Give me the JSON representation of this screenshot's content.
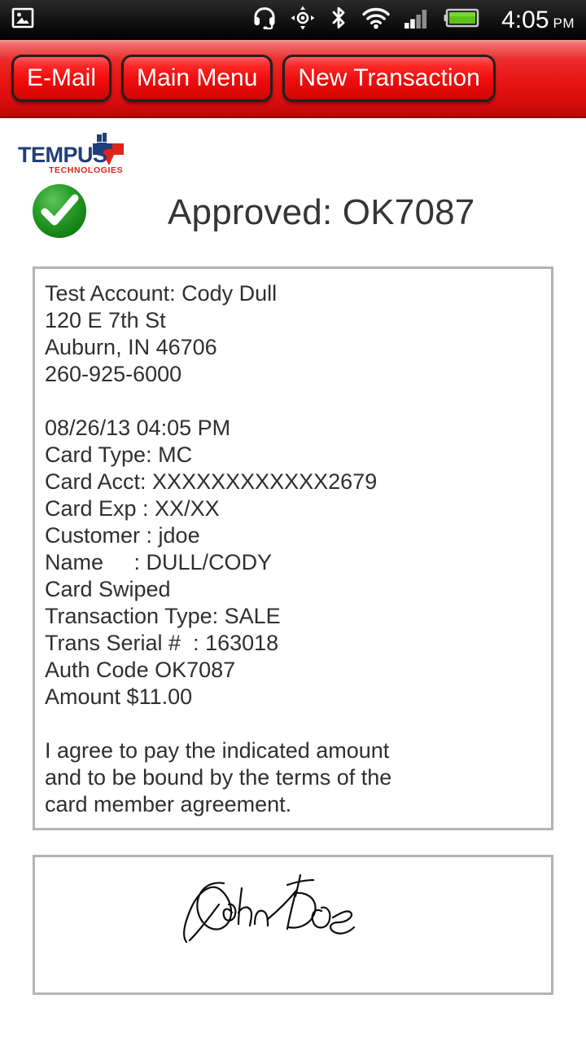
{
  "status_bar": {
    "left_icons": [
      {
        "name": "screenshot-image-icon",
        "label": "Screenshot saved"
      }
    ],
    "right_icons": [
      {
        "name": "headset-icon",
        "label": "Headset connected"
      },
      {
        "name": "gps-crosshair-icon",
        "label": "GPS active"
      },
      {
        "name": "bluetooth-icon",
        "label": "Bluetooth on"
      },
      {
        "name": "wifi-icon",
        "label": "Wi-Fi connected"
      },
      {
        "name": "cellular-signal-icon",
        "label": "Cellular signal"
      },
      {
        "name": "battery-full-icon",
        "label": "Battery full"
      }
    ],
    "clock_time": "4:05",
    "clock_ampm": "PM",
    "background": "#0a0a0a",
    "text_color": "#ffffff"
  },
  "nav_bar": {
    "background_red": "#e81414",
    "border_color": "#231f1f",
    "buttons": [
      {
        "name": "email-button",
        "label": "E-Mail"
      },
      {
        "name": "main-menu-button",
        "label": "Main Menu"
      },
      {
        "name": "new-transaction-button",
        "label": "New Transaction"
      }
    ]
  },
  "brand": {
    "name": "TEMPUS",
    "tagline": "TECHNOLOGIES",
    "navy": "#1f3f7a",
    "red": "#e2231a"
  },
  "result": {
    "status_icon": "green-check-icon",
    "status_color": "#1d9b1d",
    "heading": "Approved: OK7087",
    "heading_color": "#353535"
  },
  "receipt": {
    "border_color": "#b4b4b4",
    "text_color": "#2f2f2f",
    "lines": [
      "Test Account: Cody Dull",
      "120 E 7th St",
      "Auburn, IN 46706",
      "260-925-6000",
      "",
      "08/26/13 04:05 PM",
      "Card Type: MC",
      "Card Acct: XXXXXXXXXXXX2679",
      "Card Exp : XX/XX",
      "Customer : jdoe",
      "Name     : DULL/CODY",
      "Card Swiped",
      "Transaction Type: SALE",
      "Trans Serial #  : 163018",
      "Auth Code OK7087",
      "Amount $11.00",
      "",
      "I agree to pay the indicated amount",
      "and to be bound by the terms of the",
      "card member agreement."
    ],
    "fields": {
      "merchant_account": "Test Account: Cody Dull",
      "address_street": "120 E 7th St",
      "address_city_state_zip": "Auburn, IN 46706",
      "phone": "260-925-6000",
      "datetime": "08/26/13 04:05 PM",
      "card_type": "MC",
      "card_acct": "XXXXXXXXXXXX2679",
      "card_exp": "XX/XX",
      "customer": "jdoe",
      "name": "DULL/CODY",
      "entry_mode": "Card Swiped",
      "transaction_type": "SALE",
      "trans_serial": "163018",
      "auth_code": "OK7087",
      "amount": "$11.00"
    }
  },
  "signature": {
    "name": "signature-canvas",
    "signed_text": "John Doe",
    "ink_color": "#0d0d0d",
    "border_color": "#b4b4b4"
  }
}
